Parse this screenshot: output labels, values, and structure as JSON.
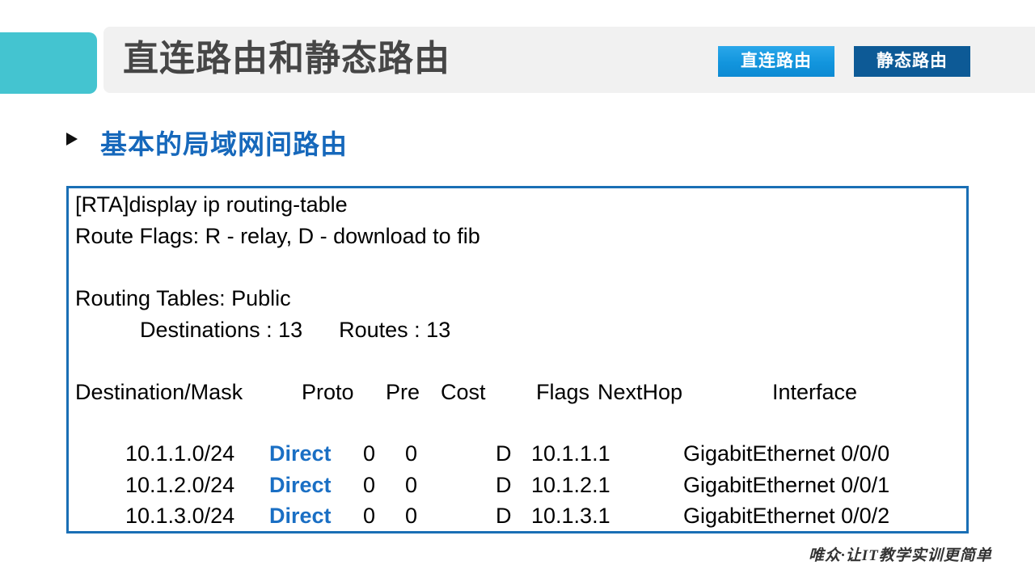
{
  "header": {
    "title": "直连路由和静态路由",
    "accent_color": "#44c4d0",
    "bar_color": "#f1f1f1",
    "title_color": "#464646",
    "badges": [
      {
        "label": "直连路由",
        "color": "#1295dd",
        "state": "active-light"
      },
      {
        "label": "静态路由",
        "color": "#0d5a96",
        "state": "active-dark"
      }
    ]
  },
  "section": {
    "bullet_icon": "triangle-right-icon",
    "title": "基本的局域网间路由",
    "title_color": "#1668bb"
  },
  "terminal": {
    "border_color": "#1a6fb5",
    "prompt_line": "[RTA]display ip routing-table",
    "flags_line": "Route Flags: R - relay, D - download to fib",
    "separator": "--------------------------------------------------------------------------------",
    "table_scope": "Routing Tables: Public",
    "summary": {
      "destinations_label": "Destinations :",
      "destinations_value": "13",
      "routes_label": "Routes :",
      "routes_value": "13",
      "text": "Destinations : 13      Routes : 13"
    },
    "columns": [
      "Destination/Mask",
      "Proto",
      "Pre",
      "Cost",
      "Flags",
      "NextHop",
      "Interface"
    ],
    "rows": [
      {
        "destination": "10.1.1.0/24",
        "proto": "Direct",
        "proto_color": "#1a6fc4",
        "pre": "0",
        "cost": "0",
        "flags": "D",
        "nexthop": "10.1.1.1",
        "interface": "GigabitEthernet 0/0/0"
      },
      {
        "destination": "10.1.2.0/24",
        "proto": "Direct",
        "proto_color": "#1a6fc4",
        "pre": "0",
        "cost": "0",
        "flags": "D",
        "nexthop": "10.1.2.1",
        "interface": "GigabitEthernet 0/0/1"
      },
      {
        "destination": "10.1.3.0/24",
        "proto": "Direct",
        "proto_color": "#1a6fc4",
        "pre": "0",
        "cost": "0",
        "flags": "D",
        "nexthop": "10.1.3.1",
        "interface": "GigabitEthernet 0/0/2"
      }
    ]
  },
  "footer": {
    "watermark": "唯众·让IT教学实训更简单"
  }
}
